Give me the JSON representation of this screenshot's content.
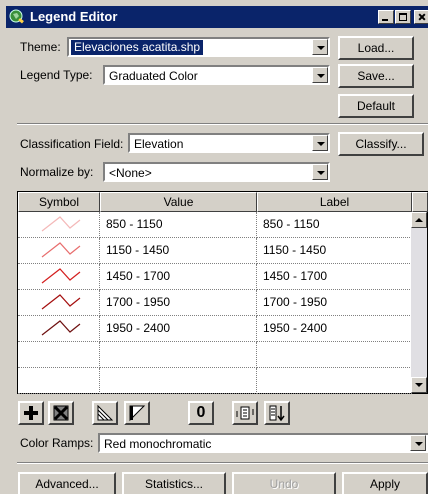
{
  "window": {
    "title": "Legend Editor",
    "icon": "globe-tool-icon",
    "controls": [
      "minimize-icon",
      "maximize-icon",
      "close-icon"
    ]
  },
  "theme": {
    "label": "Theme:",
    "value": "Elevaciones acatita.shp"
  },
  "legend_type": {
    "label": "Legend Type:",
    "value": "Graduated Color"
  },
  "buttons": {
    "load": "Load...",
    "save": "Save...",
    "default": "Default",
    "classify": "Classify..."
  },
  "classification": {
    "label": "Classification Field:",
    "value": "Elevation"
  },
  "normalize": {
    "label": "Normalize by:",
    "value": "<None>"
  },
  "table": {
    "headers": {
      "symbol": "Symbol",
      "value": "Value",
      "label": "Label"
    },
    "rows": [
      {
        "value": "850 - 1150",
        "label": "850 - 1150",
        "color": "#f4b8b8"
      },
      {
        "value": "1150 - 1450",
        "label": "1150 - 1450",
        "color": "#e86d6d"
      },
      {
        "value": "1450 - 1700",
        "label": "1450 - 1700",
        "color": "#d41f1f"
      },
      {
        "value": "1700 - 1950",
        "label": "1700 - 1950",
        "color": "#a50f0f"
      },
      {
        "value": "1950 - 2400",
        "label": "1950 - 2400",
        "color": "#6e1010"
      },
      {
        "value": "",
        "label": ""
      },
      {
        "value": "",
        "label": ""
      }
    ]
  },
  "toolbar": {
    "icons": [
      "add-class-icon",
      "delete-class-icon",
      "flip-symbols-icon",
      "ramp-icon",
      "null-value-icon",
      "advanced-label-icon",
      "sort-icon"
    ],
    "null_label": "0"
  },
  "color_ramps": {
    "label": "Color Ramps:",
    "value": "Red monochromatic"
  },
  "bottom_buttons": {
    "advanced": "Advanced...",
    "statistics": "Statistics...",
    "undo": "Undo",
    "apply": "Apply"
  },
  "colors": {
    "titlebar": "#0a246a",
    "face": "#d4d0c8",
    "selection": "#0a246a"
  }
}
